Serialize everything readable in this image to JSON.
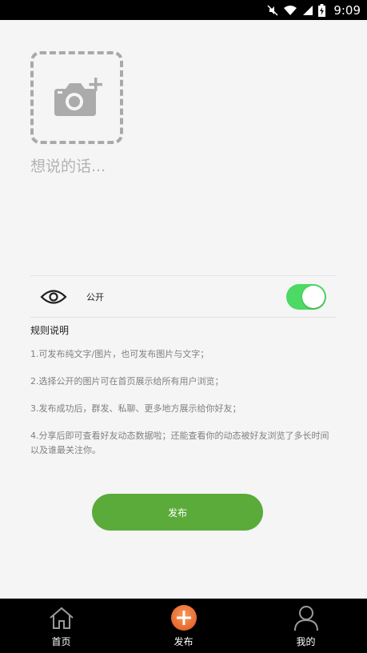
{
  "status_bar": {
    "time": "9:09",
    "icons": [
      "mute-icon",
      "wifi-icon",
      "signal-icon",
      "battery-icon"
    ]
  },
  "compose": {
    "photo_icon": "add-photo-icon",
    "text_placeholder": "想说的话..."
  },
  "visibility": {
    "icon": "eye-icon",
    "label": "公开",
    "toggle_on": true,
    "toggle_color": "#4cd964"
  },
  "rules": {
    "title": "规则说明",
    "items": [
      "1.可发布纯文字/图片，也可发布图片与文字；",
      "2.选择公开的图片可在首页展示给所有用户浏览；",
      "3.发布成功后，群发、私聊、更多地方展示给你好友；",
      "4.分享后即可查看好友动态数据啦；还能查看你的动态被好友浏览了多长时间以及谁最关注你。"
    ]
  },
  "publish_button": {
    "label": "发布",
    "color": "#5aab3a"
  },
  "bottom_nav": {
    "items": [
      {
        "label": "首页",
        "icon": "home-icon"
      },
      {
        "label": "发布",
        "icon": "add-circle-icon",
        "icon_color": "#f07a3a"
      },
      {
        "label": "我的",
        "icon": "user-icon"
      }
    ]
  }
}
